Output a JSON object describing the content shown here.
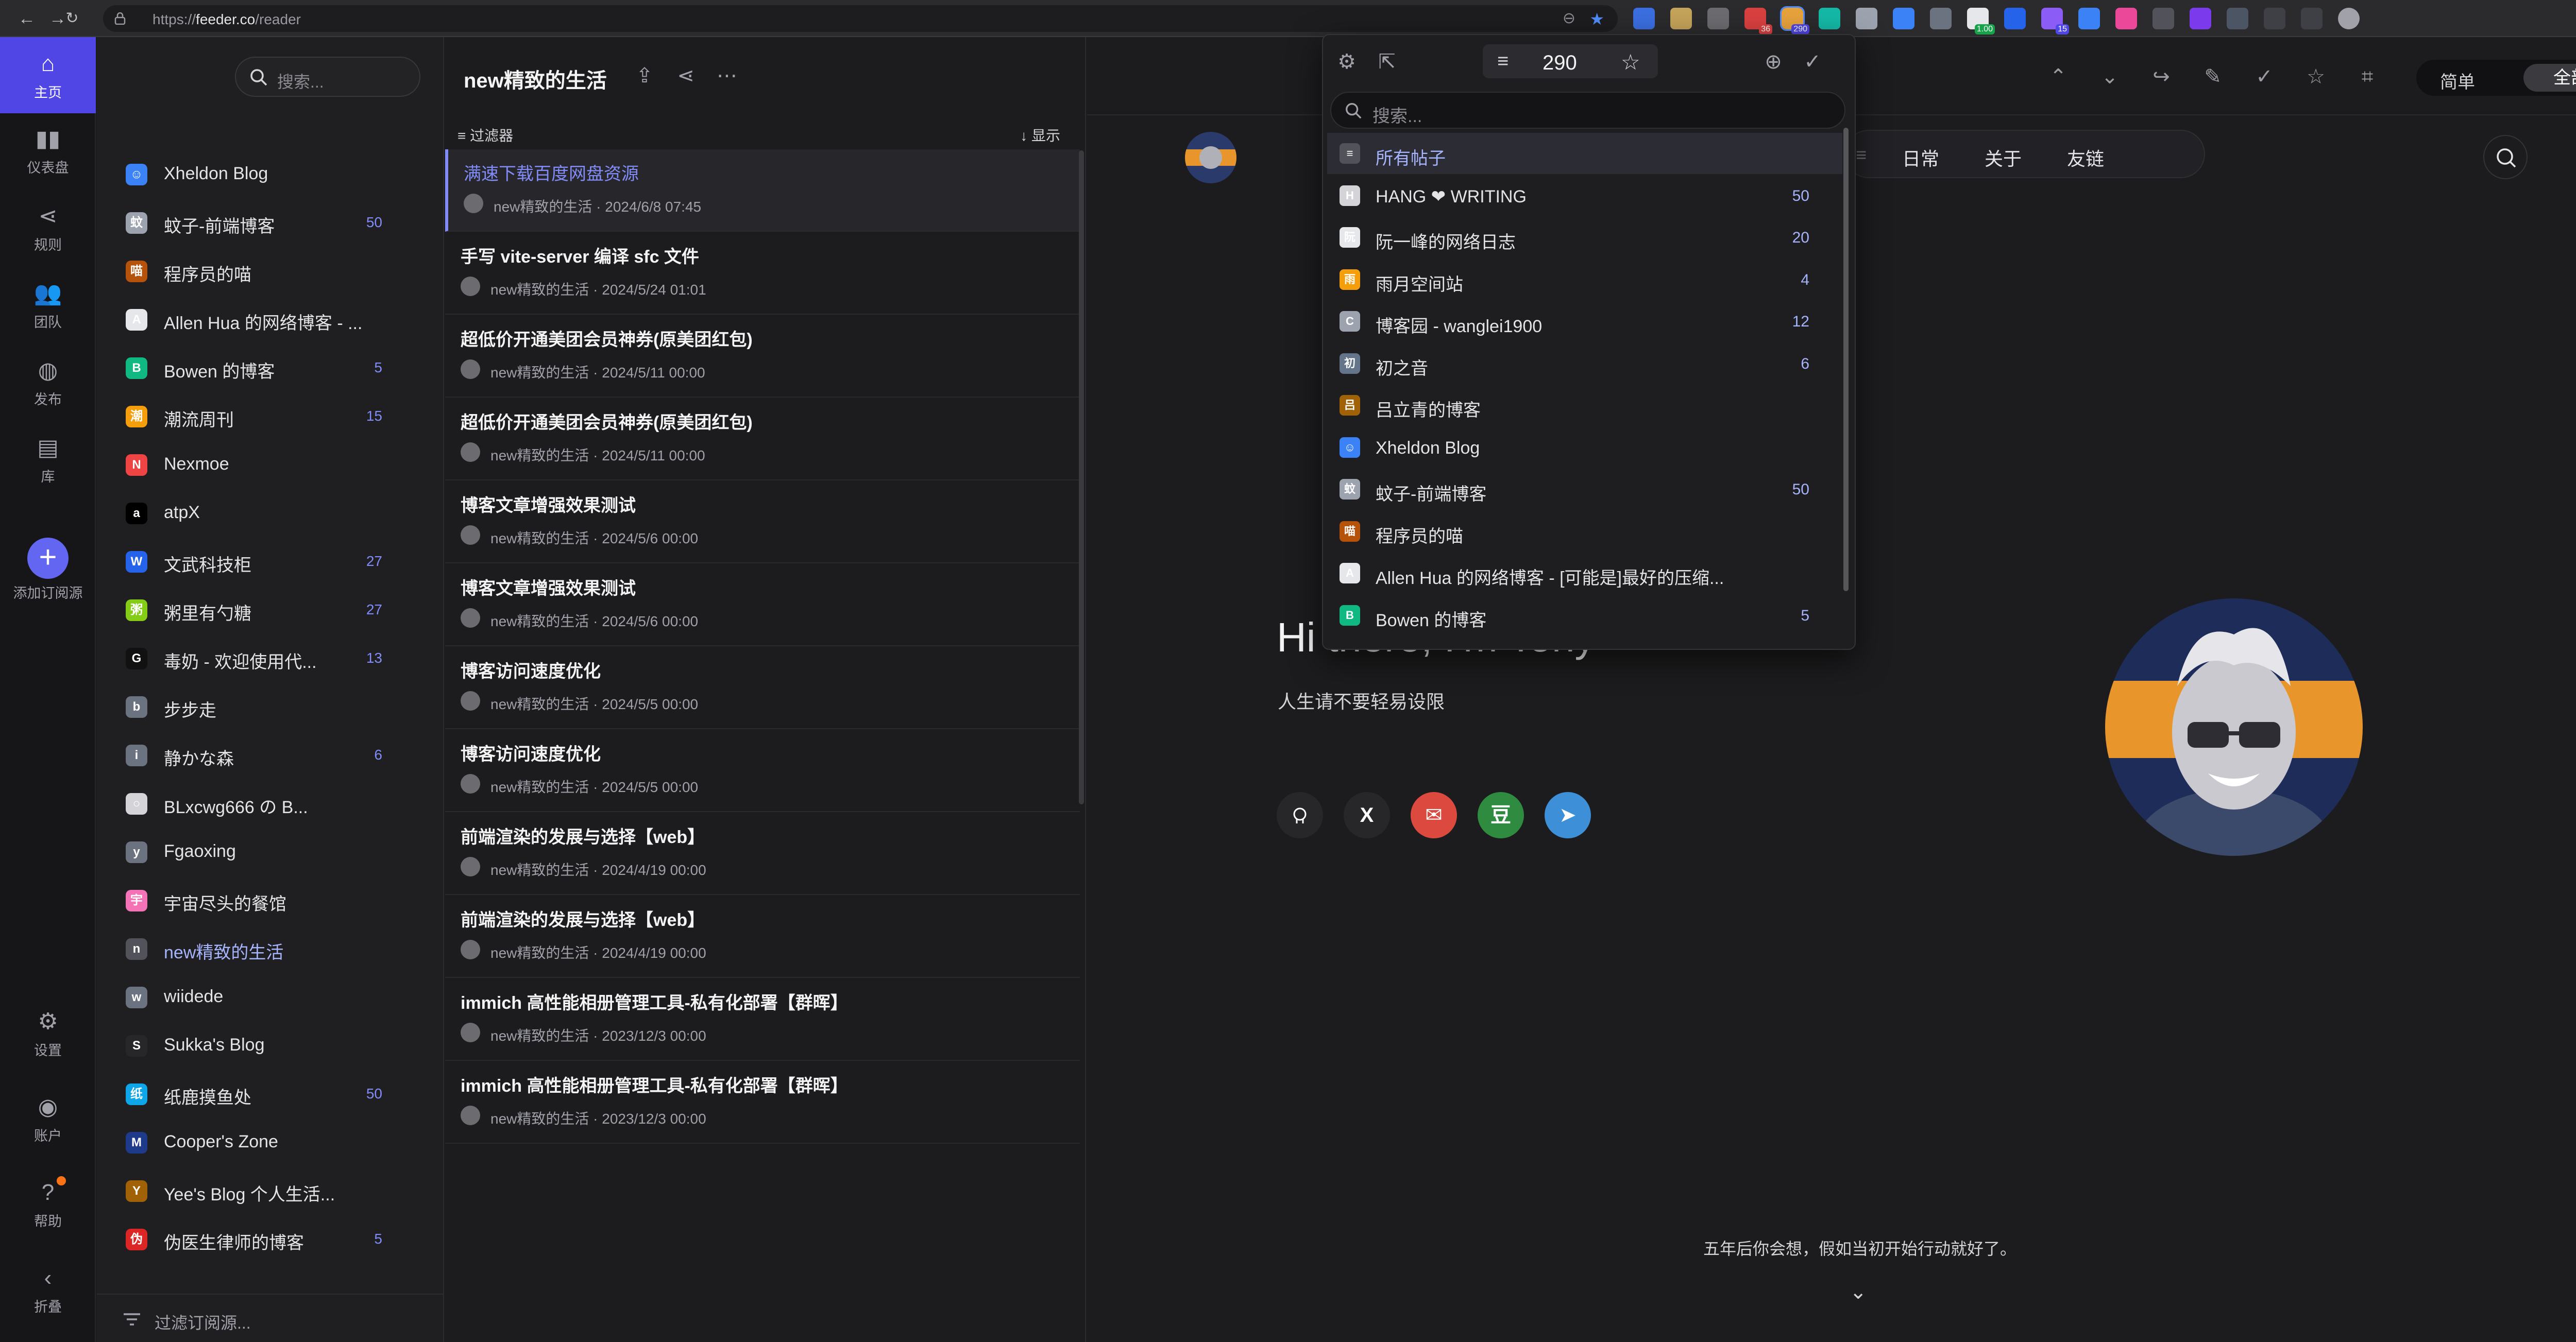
{
  "browser": {
    "url_prefix": "https://",
    "url_host": "feeder.co",
    "url_path": "/reader",
    "ext_badges": [
      "36",
      "290",
      "1.00",
      "15"
    ]
  },
  "rail": {
    "items": [
      {
        "label": "主页",
        "icon": "home-icon"
      },
      {
        "label": "仪表盘",
        "icon": "dashboard-icon"
      },
      {
        "label": "规则",
        "icon": "share-icon"
      },
      {
        "label": "团队",
        "icon": "team-icon"
      },
      {
        "label": "发布",
        "icon": "globe-icon"
      },
      {
        "label": "库",
        "icon": "archive-icon"
      }
    ],
    "add_label": "添加订阅源",
    "bottom": [
      {
        "label": "设置",
        "icon": "gear-icon"
      },
      {
        "label": "账户",
        "icon": "user-icon"
      },
      {
        "label": "帮助",
        "icon": "help-icon"
      },
      {
        "label": "折叠",
        "icon": "chevron-left-icon"
      }
    ]
  },
  "subs": {
    "search_placeholder": "搜索...",
    "filter_label": "过滤订阅源...",
    "feeds": [
      {
        "name": "Xheldon Blog",
        "count": "",
        "color": "#3b82f6",
        "glyph": "☺"
      },
      {
        "name": "蚊子-前端博客",
        "count": "50",
        "color": "#9ca3af",
        "glyph": "蚊"
      },
      {
        "name": "程序员的喵",
        "count": "",
        "color": "#b45309",
        "glyph": "喵"
      },
      {
        "name": "Allen Hua 的网络博客 - ...",
        "count": "",
        "color": "#e5e7eb",
        "glyph": "A"
      },
      {
        "name": "Bowen 的博客",
        "count": "5",
        "color": "#10b981",
        "glyph": "B"
      },
      {
        "name": "潮流周刊",
        "count": "15",
        "color": "#f59e0b",
        "glyph": "潮"
      },
      {
        "name": "Nexmoe",
        "count": "",
        "color": "#ef4444",
        "glyph": "N"
      },
      {
        "name": "atpX",
        "count": "",
        "color": "#000000",
        "glyph": "a"
      },
      {
        "name": "文武科技柜",
        "count": "27",
        "color": "#2563eb",
        "glyph": "W"
      },
      {
        "name": "粥里有勺糖",
        "count": "27",
        "color": "#84cc16",
        "glyph": "粥"
      },
      {
        "name": "毒奶 - 欢迎使用代...",
        "count": "13",
        "color": "#111111",
        "glyph": "G"
      },
      {
        "name": "步步走",
        "count": "",
        "color": "#6b7280",
        "glyph": "b"
      },
      {
        "name": "静かな森",
        "count": "6",
        "color": "#6b7280",
        "glyph": "i"
      },
      {
        "name": "BLxcwg666 の B...",
        "count": "",
        "color": "#d4d4d8",
        "glyph": "○"
      },
      {
        "name": "Fgaoxing",
        "count": "",
        "color": "#6b7280",
        "glyph": "y"
      },
      {
        "name": "宇宙尽头的餐馆",
        "count": "",
        "color": "#f472b6",
        "glyph": "宇"
      },
      {
        "name": "new精致的生活",
        "count": "",
        "color": "#52525b",
        "glyph": "n"
      },
      {
        "name": "wiidede",
        "count": "",
        "color": "#6b7280",
        "glyph": "w"
      },
      {
        "name": "Sukka's Blog",
        "count": "",
        "color": "#27272a",
        "glyph": "S"
      },
      {
        "name": "纸鹿摸鱼处",
        "count": "50",
        "color": "#0ea5e9",
        "glyph": "纸"
      },
      {
        "name": "Cooper's Zone",
        "count": "",
        "color": "#1e3a8a",
        "glyph": "M"
      },
      {
        "name": "Yee's Blog 个人生活...",
        "count": "",
        "color": "#a16207",
        "glyph": "Y"
      },
      {
        "name": "伪医生律师的博客",
        "count": "5",
        "color": "#dc2626",
        "glyph": "伪"
      }
    ]
  },
  "entries": {
    "title": "new精致的生活",
    "filter_label": "过滤器",
    "display_label": "显示",
    "items": [
      {
        "title": "满速下载百度网盘资源",
        "meta": "new精致的生活 · 2024/6/8 07:45"
      },
      {
        "title": "手写 vite-server 编译 sfc 文件",
        "meta": "new精致的生活 · 2024/5/24 01:01"
      },
      {
        "title": "超低价开通美团会员神券(原美团红包)",
        "meta": "new精致的生活 · 2024/5/11 00:00"
      },
      {
        "title": "超低价开通美团会员神券(原美团红包)",
        "meta": "new精致的生活 · 2024/5/11 00:00"
      },
      {
        "title": "博客文章增强效果测试",
        "meta": "new精致的生活 · 2024/5/6 00:00"
      },
      {
        "title": "博客文章增强效果测试",
        "meta": "new精致的生活 · 2024/5/6 00:00"
      },
      {
        "title": "博客访问速度优化",
        "meta": "new精致的生活 · 2024/5/5 00:00"
      },
      {
        "title": "博客访问速度优化",
        "meta": "new精致的生活 · 2024/5/5 00:00"
      },
      {
        "title": "前端渲染的发展与选择【web】",
        "meta": "new精致的生活 · 2024/4/19 00:00"
      },
      {
        "title": "前端渲染的发展与选择【web】",
        "meta": "new精致的生活 · 2024/4/19 00:00"
      },
      {
        "title": "immich 高性能相册管理工具-私有化部署【群晖】",
        "meta": "new精致的生活 · 2023/12/3 00:00"
      },
      {
        "title": "immich 高性能相册管理工具-私有化部署【群晖】",
        "meta": "new精致的生活 · 2023/12/3 00:00"
      }
    ]
  },
  "content": {
    "mode_simple": "简单",
    "mode_all": "全部",
    "nav": [
      "日常",
      "关于",
      "友链"
    ],
    "hero_title": "Hi there, I'm Tony",
    "hero_sub": "人生请不要轻易设限",
    "social": [
      {
        "name": "github-icon",
        "label": "",
        "color": "#27272a"
      },
      {
        "name": "x-icon",
        "label": "X",
        "color": "#27272a"
      },
      {
        "name": "mail-icon",
        "label": "✉",
        "color": "#dc4a3f"
      },
      {
        "name": "douban-icon",
        "label": "豆",
        "color": "#2e8b3f"
      },
      {
        "name": "telegram-icon",
        "label": "➤",
        "color": "#3d8fd8"
      }
    ],
    "footer_quote": "五年后你会想，假如当初开始行动就好了。"
  },
  "dropdown": {
    "count": "290",
    "search_placeholder": "搜索...",
    "items": [
      {
        "name": "所有帖子",
        "count": "",
        "color": "#52525b",
        "glyph": "≡"
      },
      {
        "name": "HANG ❤ WRITING",
        "count": "50",
        "color": "#d4d4d8",
        "glyph": "H"
      },
      {
        "name": "阮一峰的网络日志",
        "count": "20",
        "color": "#e5e7eb",
        "glyph": "阮"
      },
      {
        "name": "雨月空间站",
        "count": "4",
        "color": "#f59e0b",
        "glyph": "雨"
      },
      {
        "name": "博客园 - wanglei1900",
        "count": "12",
        "color": "#9ca3af",
        "glyph": "C"
      },
      {
        "name": "初之音",
        "count": "6",
        "color": "#64748b",
        "glyph": "初"
      },
      {
        "name": "吕立青的博客",
        "count": "",
        "color": "#a16207",
        "glyph": "吕"
      },
      {
        "name": "Xheldon Blog",
        "count": "",
        "color": "#3b82f6",
        "glyph": "☺"
      },
      {
        "name": "蚊子-前端博客",
        "count": "50",
        "color": "#9ca3af",
        "glyph": "蚊"
      },
      {
        "name": "程序员的喵",
        "count": "",
        "color": "#b45309",
        "glyph": "喵"
      },
      {
        "name": "Allen Hua 的网络博客 - [可能是]最好的压缩...",
        "count": "",
        "color": "#e5e7eb",
        "glyph": "A"
      },
      {
        "name": "Bowen 的博客",
        "count": "5",
        "color": "#10b981",
        "glyph": "B"
      }
    ]
  },
  "colors": {
    "accent": "#6366f1",
    "accent_text": "#818cf8",
    "rail_active": "#4f46e5"
  }
}
